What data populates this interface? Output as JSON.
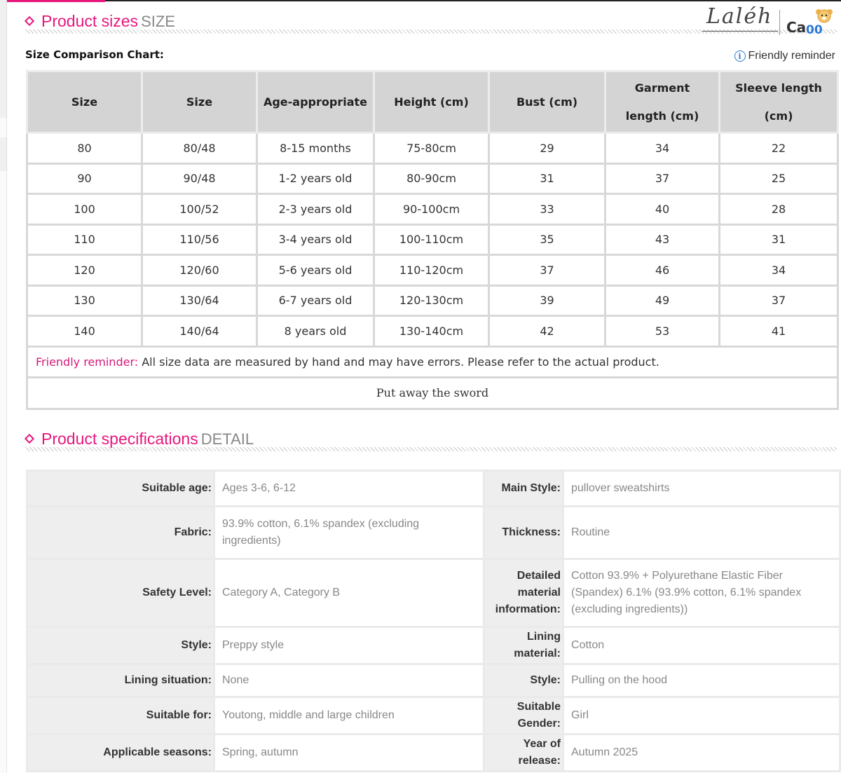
{
  "size_section": {
    "title": "Product sizes",
    "title_en": "SIZE"
  },
  "brand": {
    "signature": "Laléh",
    "logo_text": "Ca00"
  },
  "chart_label": "Size Comparison Chart:",
  "reminder_top": "Friendly reminder",
  "size_table": {
    "headers": [
      "Size",
      "Size",
      "Age-appropriate",
      "Height (cm)",
      "Bust (cm)",
      "Garment length (cm)",
      "Sleeve length (cm)"
    ],
    "rows": [
      [
        "80",
        "80/48",
        "8-15 months",
        "75-80cm",
        "29",
        "34",
        "22"
      ],
      [
        "90",
        "90/48",
        "1-2 years old",
        "80-90cm",
        "31",
        "37",
        "25"
      ],
      [
        "100",
        "100/52",
        "2-3 years old",
        "90-100cm",
        "33",
        "40",
        "28"
      ],
      [
        "110",
        "110/56",
        "3-4 years old",
        "100-110cm",
        "35",
        "43",
        "31"
      ],
      [
        "120",
        "120/60",
        "5-6 years old",
        "110-120cm",
        "37",
        "46",
        "34"
      ],
      [
        "130",
        "130/64",
        "6-7 years old",
        "120-130cm",
        "39",
        "49",
        "37"
      ],
      [
        "140",
        "140/64",
        "8 years old",
        "130-140cm",
        "42",
        "53",
        "41"
      ]
    ],
    "note_label": "Friendly reminder:",
    "note_text": " All size data are measured by hand and may have errors. Please refer to the actual product.",
    "footer": "Put away the sword"
  },
  "spec_section": {
    "title": "Product specifications",
    "title_en": "DETAIL"
  },
  "spec_table": {
    "rows": [
      [
        "Suitable age:",
        "Ages 3-6, 6-12",
        "Main Style:",
        "pullover sweatshirts"
      ],
      [
        "Fabric:",
        "93.9% cotton, 6.1% spandex (excluding ingredients)",
        "Thickness:",
        "Routine"
      ],
      [
        "Safety Level:",
        "Category A, Category B",
        "Detailed material information:",
        "Cotton 93.9% + Polyurethane Elastic Fiber (Spandex) 6.1% (93.9% cotton, 6.1% spandex (excluding ingredients))"
      ],
      [
        "Style:",
        "Preppy style",
        "Lining material:",
        "Cotton"
      ],
      [
        "Lining situation:",
        "None",
        "Style:",
        "Pulling on the hood"
      ],
      [
        "Suitable for:",
        "Youtong, middle and large children",
        "Suitable Gender:",
        "Girl"
      ],
      [
        "Applicable seasons:",
        "Spring, autumn",
        "Year of release:",
        "Autumn 2025"
      ]
    ]
  },
  "colors": {
    "accent": "#e8177d",
    "header_bg": "#d4d4d4",
    "border": "#d8d8d8",
    "info_blue": "#2a7ad8"
  }
}
